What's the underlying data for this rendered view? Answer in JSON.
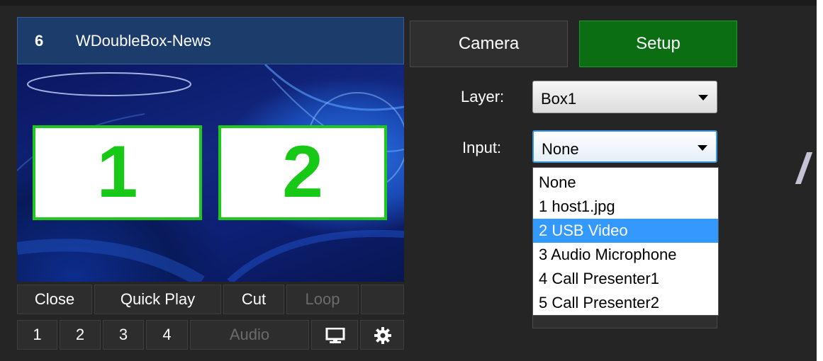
{
  "header": {
    "number": "6",
    "title": "WDoubleBox-News"
  },
  "preview": {
    "slot1": "1",
    "slot2": "2",
    "accent": "#1fc81f"
  },
  "controls": {
    "row1": [
      "Close",
      "Quick Play",
      "Cut",
      "Loop"
    ],
    "row2": [
      "1",
      "2",
      "3",
      "4",
      "Audio"
    ],
    "icons": [
      "monitor-icon",
      "gear-icon"
    ]
  },
  "tabs": {
    "camera": "Camera",
    "setup": "Setup"
  },
  "layer": {
    "label": "Layer:",
    "value": "Box1"
  },
  "input": {
    "label": "Input:",
    "value": "None",
    "options": [
      "None",
      "1 host1.jpg",
      "2 USB Video",
      "3 Audio Microphone",
      "4 Call Presenter1",
      "5 Call Presenter2"
    ],
    "highlighted": "2 USB Video"
  },
  "colors": {
    "header": "#1c3c6c",
    "setup": "#0b6e13",
    "highlight": "#3399ff",
    "panel": "#252525"
  }
}
